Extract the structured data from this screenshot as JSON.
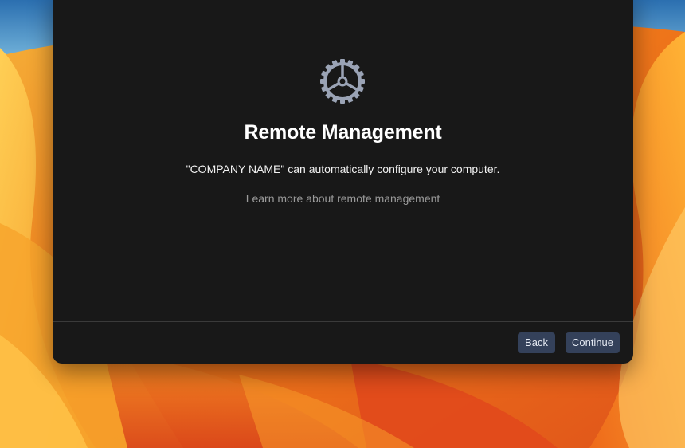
{
  "dialog": {
    "icon": "gear-icon",
    "title": "Remote Management",
    "description": "\"COMPANY NAME\" can automatically configure your computer.",
    "learn_more": "Learn more about remote management"
  },
  "footer": {
    "back_label": "Back",
    "continue_label": "Continue"
  },
  "colors": {
    "dialog_background": "#181818",
    "button_background": "#34415a",
    "link_color": "#9b9b9b",
    "wallpaper_orange": "#f07a1a"
  }
}
